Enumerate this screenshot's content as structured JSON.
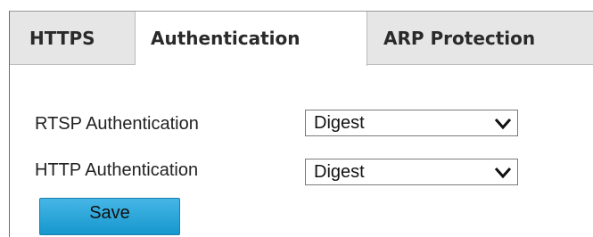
{
  "tabs": [
    {
      "label": "HTTPS",
      "active": false
    },
    {
      "label": "Authentication",
      "active": true
    },
    {
      "label": "ARP Protection",
      "active": false
    }
  ],
  "form": {
    "rtsp": {
      "label": "RTSP Authentication",
      "value": "Digest"
    },
    "http": {
      "label": "HTTP Authentication",
      "value": "Digest"
    }
  },
  "buttons": {
    "save_label": "Save"
  },
  "icons": {
    "dropdown": "chevron-down-icon"
  },
  "colors": {
    "save_button": "#1a9fd8",
    "active_tab": "#ffffff",
    "inactive_tab": "#e6e6e6"
  }
}
